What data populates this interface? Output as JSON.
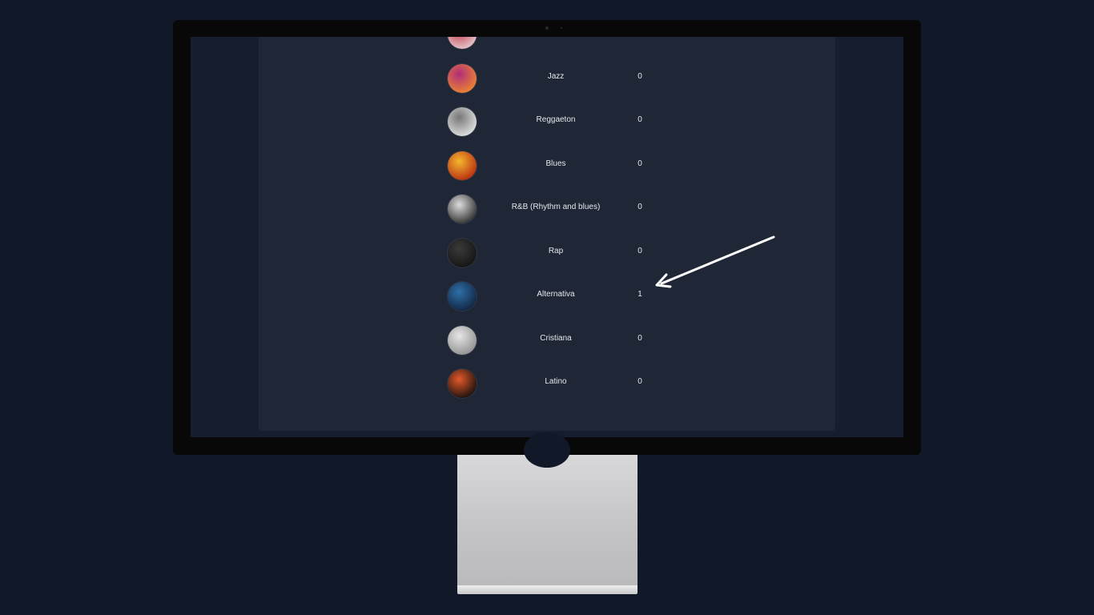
{
  "genre_list": {
    "items": [
      {
        "name": "",
        "count": "",
        "icon": "partial-avatar-icon",
        "colors": [
          "#c0394b",
          "#e8d3d8"
        ]
      },
      {
        "name": "Jazz",
        "count": "0",
        "icon": "jazz-avatar-icon",
        "colors": [
          "#b02d7a",
          "#f28c2a"
        ]
      },
      {
        "name": "Reggaeton",
        "count": "0",
        "icon": "reggaeton-avatar-icon",
        "colors": [
          "#777777",
          "#e9e9e9"
        ]
      },
      {
        "name": "Blues",
        "count": "0",
        "icon": "blues-avatar-icon",
        "colors": [
          "#f4b72f",
          "#b3220f"
        ]
      },
      {
        "name": "R&B (Rhythm and blues)",
        "count": "0",
        "icon": "rnb-avatar-icon",
        "colors": [
          "#dcdcdc",
          "#222222"
        ]
      },
      {
        "name": "Rap",
        "count": "0",
        "icon": "rap-avatar-icon",
        "colors": [
          "#3a3a3a",
          "#111111"
        ]
      },
      {
        "name": "Alternativa",
        "count": "1",
        "icon": "alternativa-avatar-icon",
        "colors": [
          "#2f6fa8",
          "#0e1f3a"
        ]
      },
      {
        "name": "Cristiana",
        "count": "0",
        "icon": "cristiana-avatar-icon",
        "colors": [
          "#e6e6e6",
          "#8a8a8a"
        ]
      },
      {
        "name": "Latino",
        "count": "0",
        "icon": "latino-avatar-icon",
        "colors": [
          "#e2592a",
          "#0a0a0a"
        ]
      }
    ]
  },
  "theme": {
    "page_bg": "#111827",
    "panel_bg": "#1f2737",
    "text": "#e5e7eb",
    "arrow": "#ffffff"
  }
}
